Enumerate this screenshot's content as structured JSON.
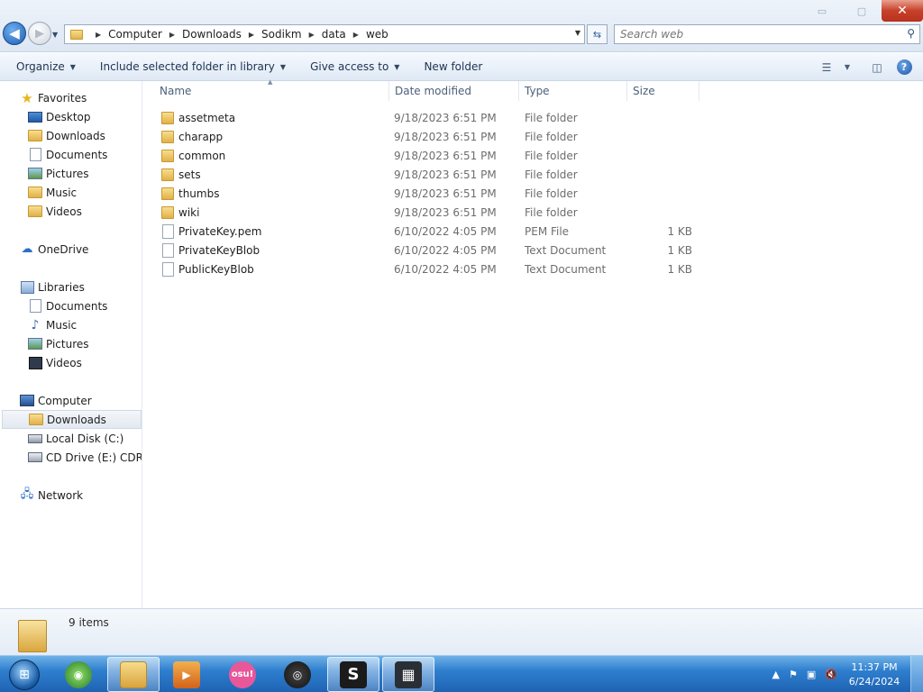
{
  "window": {
    "minimize_glyph": "▭",
    "maximize_glyph": "▢",
    "close_glyph": "✕"
  },
  "addressbar": {
    "crumbs": [
      "Computer",
      "Downloads",
      "Sodikm",
      "data",
      "web"
    ]
  },
  "search": {
    "placeholder": "Search web"
  },
  "toolbar": {
    "organize": "Organize",
    "include_library": "Include selected folder in library",
    "give_access": "Give access to",
    "new_folder": "New folder"
  },
  "navpane": {
    "favorites": "Favorites",
    "fav_items": [
      "Desktop",
      "Downloads",
      "Documents",
      "Pictures",
      "Music",
      "Videos"
    ],
    "onedrive": "OneDrive",
    "libraries": "Libraries",
    "lib_items": [
      "Documents",
      "Music",
      "Pictures",
      "Videos"
    ],
    "computer": "Computer",
    "comp_items": [
      "Downloads",
      "Local Disk (C:)",
      "CD Drive (E:) CDROM"
    ],
    "network": "Network"
  },
  "columns": {
    "name": "Name",
    "date": "Date modified",
    "type": "Type",
    "size": "Size"
  },
  "files": [
    {
      "name": "assetmeta",
      "date": "9/18/2023 6:51 PM",
      "type": "File folder",
      "size": "",
      "icon": "folder-icon"
    },
    {
      "name": "charapp",
      "date": "9/18/2023 6:51 PM",
      "type": "File folder",
      "size": "",
      "icon": "folder-icon"
    },
    {
      "name": "common",
      "date": "9/18/2023 6:51 PM",
      "type": "File folder",
      "size": "",
      "icon": "folder-icon"
    },
    {
      "name": "sets",
      "date": "9/18/2023 6:51 PM",
      "type": "File folder",
      "size": "",
      "icon": "folder-icon"
    },
    {
      "name": "thumbs",
      "date": "9/18/2023 6:51 PM",
      "type": "File folder",
      "size": "",
      "icon": "folder-icon"
    },
    {
      "name": "wiki",
      "date": "9/18/2023 6:51 PM",
      "type": "File folder",
      "size": "",
      "icon": "folder-icon"
    },
    {
      "name": "PrivateKey.pem",
      "date": "6/10/2022 4:05 PM",
      "type": "PEM File",
      "size": "1 KB",
      "icon": "file-icon"
    },
    {
      "name": "PrivateKeyBlob",
      "date": "6/10/2022 4:05 PM",
      "type": "Text Document",
      "size": "1 KB",
      "icon": "text-file-icon"
    },
    {
      "name": "PublicKeyBlob",
      "date": "6/10/2022 4:05 PM",
      "type": "Text Document",
      "size": "1 KB",
      "icon": "text-file-icon"
    }
  ],
  "details": {
    "item_count": "9 items"
  },
  "taskbar": {
    "apps": [
      "explorer-icon",
      "media-player-icon",
      "osu-icon",
      "obs-icon",
      "s-app-icon",
      "gift-app-icon"
    ],
    "osu_label": "osu!",
    "clock_time": "11:37 PM",
    "clock_date": "6/24/2024"
  },
  "colors": {
    "accent": "#1f63b3",
    "close": "#c7402a"
  }
}
